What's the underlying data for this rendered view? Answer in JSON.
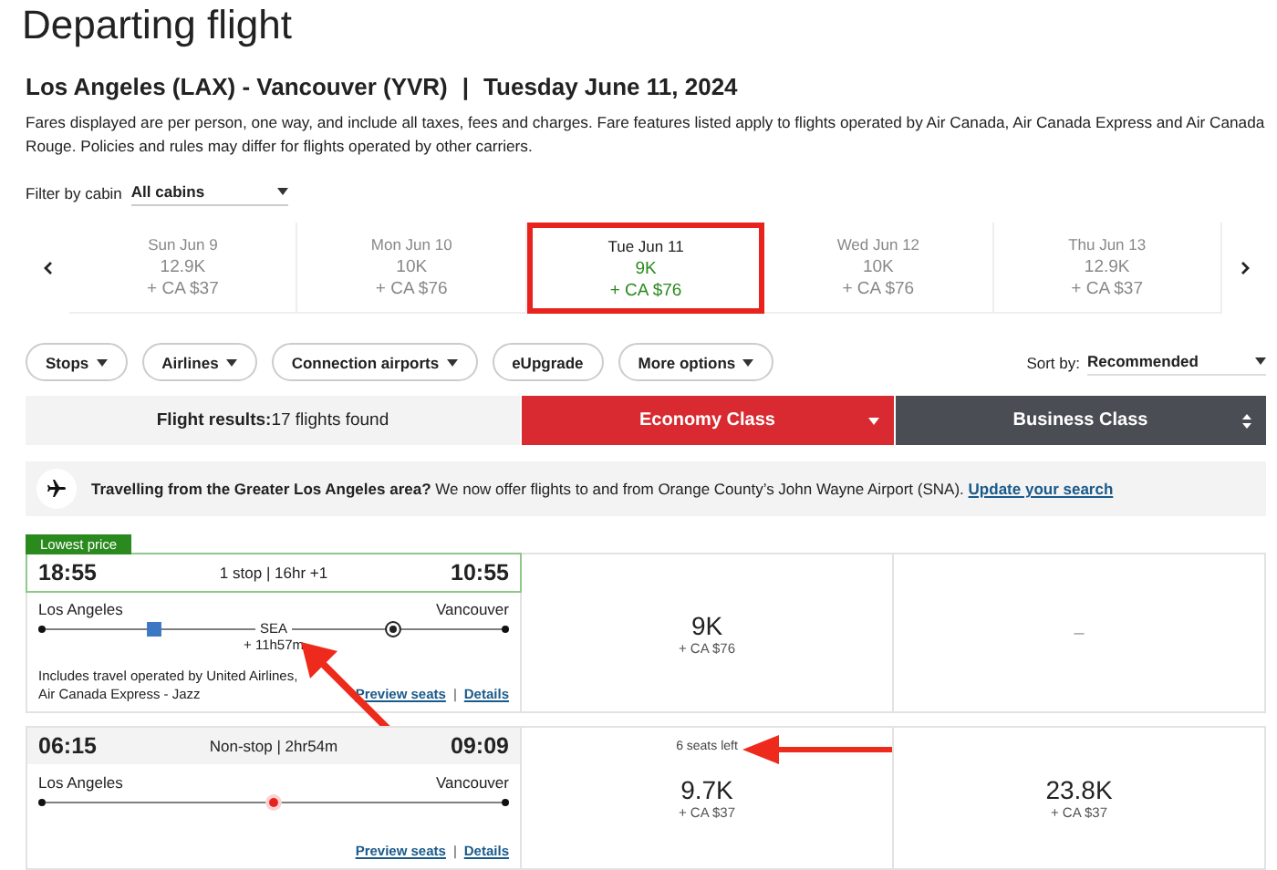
{
  "page_title": "Departing flight",
  "route": {
    "cities": "Los Angeles (LAX) - Vancouver (YVR)",
    "separator": "|",
    "date": "Tuesday June 11, 2024"
  },
  "fare_note": "Fares displayed are per person, one way, and include all taxes, fees and charges. Fare features listed apply to flights operated by Air Canada, Air Canada Express and Air Canada Rouge. Policies and rules may differ for flights operated by other carriers.",
  "cabin_filter": {
    "label": "Filter by cabin",
    "value": "All cabins"
  },
  "dates": [
    {
      "day": "Sun Jun 9",
      "points": "12.9K",
      "cash": "+ CA $37",
      "selected": false,
      "highlighted": false
    },
    {
      "day": "Mon Jun 10",
      "points": "10K",
      "cash": "+ CA $76",
      "selected": false,
      "highlighted": false
    },
    {
      "day": "Tue Jun 11",
      "points": "9K",
      "cash": "+ CA $76",
      "selected": true,
      "highlighted": true
    },
    {
      "day": "Wed Jun 12",
      "points": "10K",
      "cash": "+ CA $76",
      "selected": false,
      "highlighted": false
    },
    {
      "day": "Thu Jun 13",
      "points": "12.9K",
      "cash": "+ CA $37",
      "selected": false,
      "highlighted": false
    }
  ],
  "filters": [
    {
      "label": "Stops",
      "dropdown": true
    },
    {
      "label": "Airlines",
      "dropdown": true
    },
    {
      "label": "Connection airports",
      "dropdown": true
    },
    {
      "label": "eUpgrade",
      "dropdown": false
    },
    {
      "label": "More options",
      "dropdown": true
    }
  ],
  "sort": {
    "label": "Sort by:",
    "value": "Recommended"
  },
  "results": {
    "label": "Flight results:",
    "count": "17 flights found"
  },
  "cabins": [
    {
      "label": "Economy Class",
      "selected": true
    },
    {
      "label": "Business Class",
      "selected": false
    }
  ],
  "notice": {
    "text": "**Travelling from the Greater Los Angeles area?** We now offer flights to and from Orange County’s John Wayne Airport (SNA).",
    "link": "Update your search"
  },
  "flights": [
    {
      "badge": "Lowest price",
      "depart": "18:55",
      "summary": "1 stop | 16hr +1",
      "arrive": "10:55",
      "from": "Los Angeles",
      "to": "Vancouver",
      "stop": {
        "code": "SEA",
        "layover": "+ 11h57m",
        "marked": true
      },
      "operated": "Includes travel operated by United Airlines, Air Canada Express - Jazz",
      "preview": "Preview seats",
      "link_separator": "|",
      "details": "Details",
      "fares": [
        {
          "kind": "price",
          "points": "9K",
          "cash": "+ CA $76"
        },
        {
          "kind": "none",
          "label": "–"
        }
      ]
    },
    {
      "depart": "06:15",
      "summary": "Non-stop | 2hr54m",
      "arrive": "09:09",
      "from": "Los Angeles",
      "to": "Vancouver",
      "preview": "Preview seats",
      "link_separator": "|",
      "details": "Details",
      "fares": [
        {
          "kind": "price",
          "points": "9.7K",
          "cash": "+ CA $37",
          "seats_left": "6 seats left",
          "marked": true
        },
        {
          "kind": "price",
          "points": "23.8K",
          "cash": "+ CA $37"
        }
      ]
    }
  ]
}
